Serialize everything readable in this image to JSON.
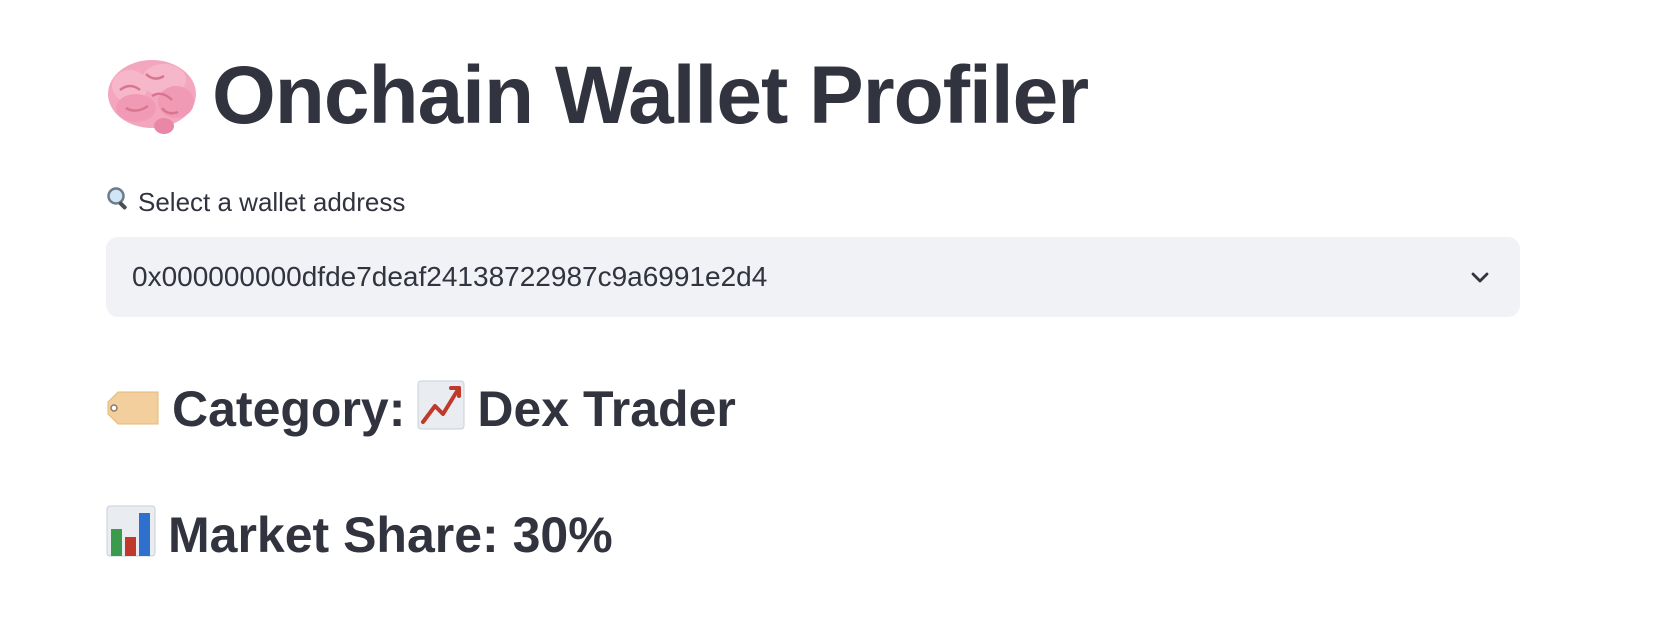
{
  "page": {
    "title": "Onchain Wallet Profiler",
    "title_icon": "brain-icon"
  },
  "wallet_select": {
    "label": "Select a wallet address",
    "label_icon": "magnifier-icon",
    "selected_value": "0x000000000dfde7deaf24138722987c9a6991e2d4",
    "dropdown_icon": "chevron-down-icon"
  },
  "category": {
    "label": "Category:",
    "value": "Dex Trader",
    "label_icon": "tag-icon",
    "value_icon": "chart-increasing-icon"
  },
  "market_share": {
    "label": "Market Share: 30%",
    "label_icon": "bar-chart-icon"
  },
  "colors": {
    "text": "#31333f",
    "select_background": "#f0f2f6",
    "page_background": "#ffffff"
  }
}
